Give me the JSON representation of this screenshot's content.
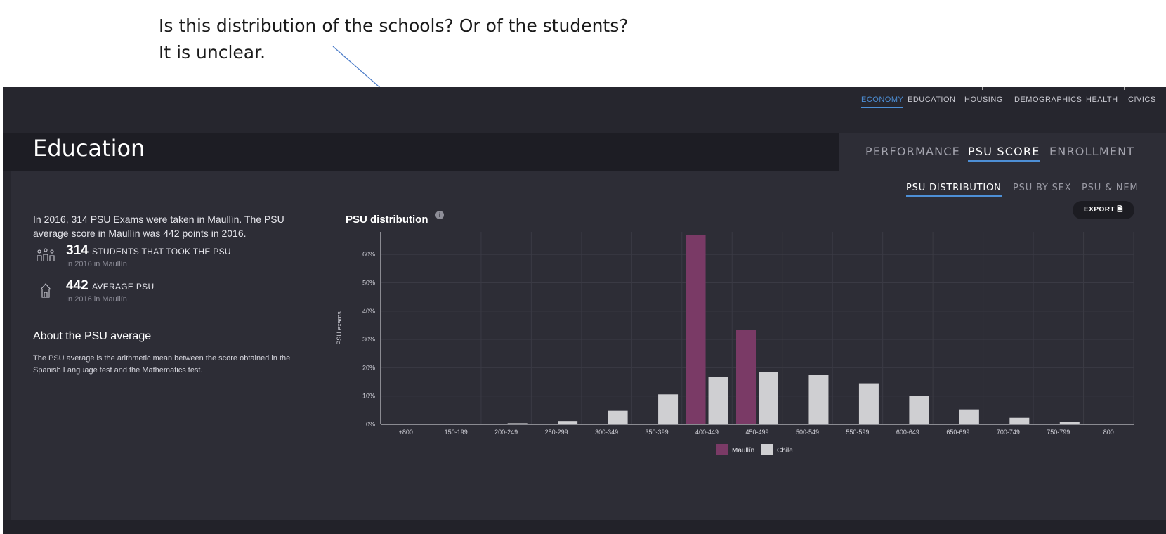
{
  "annotation": {
    "line1": "Is this distribution of the schools? Or of the students?",
    "line2": "It is unclear."
  },
  "top_nav": [
    "ECONOMY",
    "EDUCATION",
    "HOUSING",
    "DEMOGRAPHICS",
    "HEALTH",
    "CIVICS"
  ],
  "page_title": "Education",
  "tabs": [
    "PERFORMANCE",
    "PSU SCORE",
    "ENROLLMENT"
  ],
  "subtabs": [
    "PSU DISTRIBUTION",
    "PSU BY SEX",
    "PSU & NEM"
  ],
  "intro": "In 2016, 314 PSU Exams were taken in Maullín. The PSU average score in Maullín was 442 points in 2016.",
  "stats": [
    {
      "value": "314",
      "label": "students that took the PSU",
      "sub": "In 2016 in Maullín",
      "icon": "students-icon"
    },
    {
      "value": "442",
      "label": "average PSU",
      "sub": "In 2016 in Maullín",
      "icon": "school-icon"
    }
  ],
  "about": {
    "title": "About the PSU average",
    "text": "The PSU average is the arithmetic mean between the score obtained in the Spanish Language test and the Mathematics test."
  },
  "export_label": "EXPORT",
  "colors": {
    "maullin": "#7a3a66",
    "chile": "#cfcfd2",
    "accent": "#4d8fd6",
    "background": "#26262e",
    "panel": "#2d2d36"
  },
  "chart_data": {
    "type": "bar",
    "title": "PSU distribution",
    "ylabel": "PSU exams",
    "xlabel": "",
    "categories": [
      "+800",
      "150-199",
      "200-249",
      "250-299",
      "300-349",
      "350-399",
      "400-449",
      "450-499",
      "500-549",
      "550-599",
      "600-649",
      "650-699",
      "700-749",
      "750-799",
      "800"
    ],
    "series": [
      {
        "name": "Maullín",
        "values": [
          0,
          0,
          0,
          0,
          0,
          0,
          67,
          33.5,
          0,
          0,
          0,
          0,
          0,
          0,
          0
        ]
      },
      {
        "name": "Chile",
        "values": [
          0,
          0,
          0.4,
          1.2,
          4.8,
          10.6,
          16.8,
          18.4,
          17.6,
          14.5,
          10,
          5.3,
          2.3,
          0.8,
          0
        ]
      }
    ],
    "y_ticks": [
      "0%",
      "10%",
      "20%",
      "30%",
      "40%",
      "50%",
      "60%"
    ],
    "ylim": [
      0,
      68
    ],
    "grid": true,
    "legend_position": "bottom-center"
  }
}
